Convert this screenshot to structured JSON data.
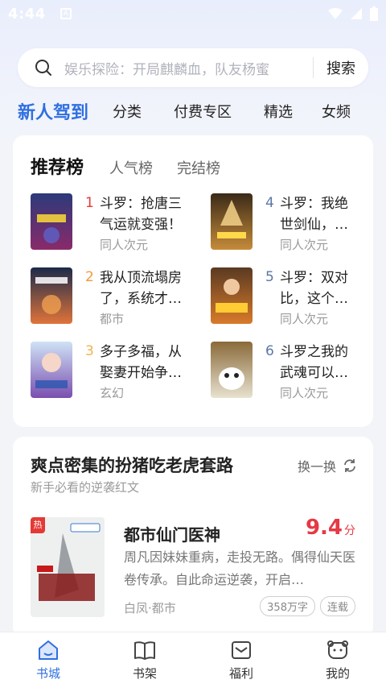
{
  "status": {
    "time": "4:44",
    "notif": "A"
  },
  "search": {
    "placeholder": "娱乐探险：开局麒麟血，队友杨蜜",
    "button": "搜索"
  },
  "tabs": [
    {
      "label": "新人驾到",
      "active": true
    },
    {
      "label": "分类"
    },
    {
      "label": "付费专区"
    },
    {
      "label": "精选"
    },
    {
      "label": "女频"
    }
  ],
  "ranking": {
    "tabs": [
      {
        "label": "推荐榜",
        "active": true
      },
      {
        "label": "人气榜"
      },
      {
        "label": "完结榜"
      }
    ],
    "items": [
      {
        "rank": "1",
        "title": "斗罗：抢唐三\n气运就变强！",
        "genre": "同人次元"
      },
      {
        "rank": "2",
        "title": "我从顶流塌房\n了，系统才…",
        "genre": "都市"
      },
      {
        "rank": "3",
        "title": "多子多福，从\n娶妻开始争…",
        "genre": "玄幻"
      },
      {
        "rank": "4",
        "title": "斗罗：我绝\n世剑仙，…",
        "genre": "同人次元"
      },
      {
        "rank": "5",
        "title": "斗罗：双对\n比，这个…",
        "genre": "同人次元"
      },
      {
        "rank": "6",
        "title": "斗罗之我的\n武魂可以…",
        "genre": "同人次元"
      }
    ],
    "rank_colors": {
      "top": "#e53935",
      "second": "#f29a38",
      "third": "#f2b24f",
      "other": "#5b77a8"
    }
  },
  "promo": {
    "title": "爽点密集的扮猪吃老虎套路",
    "subtitle": "新手必看的逆袭红文",
    "refresh_label": "换一换",
    "book": {
      "hot_badge": "热",
      "title": "都市仙门医神",
      "score": "9.4",
      "score_unit": "分",
      "description": "周凡因妹妹重病，走投无路。偶得仙天医卷传承。自此命运逆袭，开启…",
      "author_genre": "白凤·都市",
      "tags": [
        "358万字",
        "连载"
      ]
    }
  },
  "bottom_nav": [
    {
      "label": "书城",
      "icon": "bookstore-icon",
      "active": true
    },
    {
      "label": "书架",
      "icon": "bookshelf-icon"
    },
    {
      "label": "福利",
      "icon": "welfare-icon"
    },
    {
      "label": "我的",
      "icon": "profile-icon"
    }
  ],
  "colors": {
    "accent": "#2f6fe0",
    "score": "#e53945"
  }
}
